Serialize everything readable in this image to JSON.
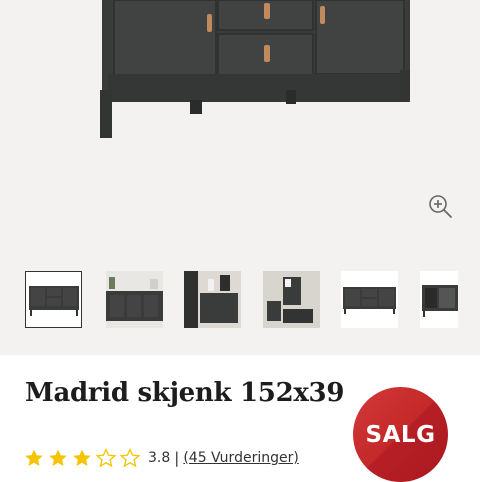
{
  "product": {
    "title": "Madrid skjenk 152x39",
    "rating_value": "3.8",
    "rating_stars": 3.8,
    "rating_separator": "|",
    "reviews_link": "(45 Vurderinger)",
    "sale_badge": "SALG"
  },
  "gallery": {
    "zoom_icon": "zoom-in-icon",
    "thumbnails_count_visible": 6,
    "active_thumbnail": 0
  },
  "colors": {
    "star": "#f5c400",
    "sale": "#c42828",
    "furniture": "#3a3c3c",
    "handle": "#c08a5e"
  }
}
